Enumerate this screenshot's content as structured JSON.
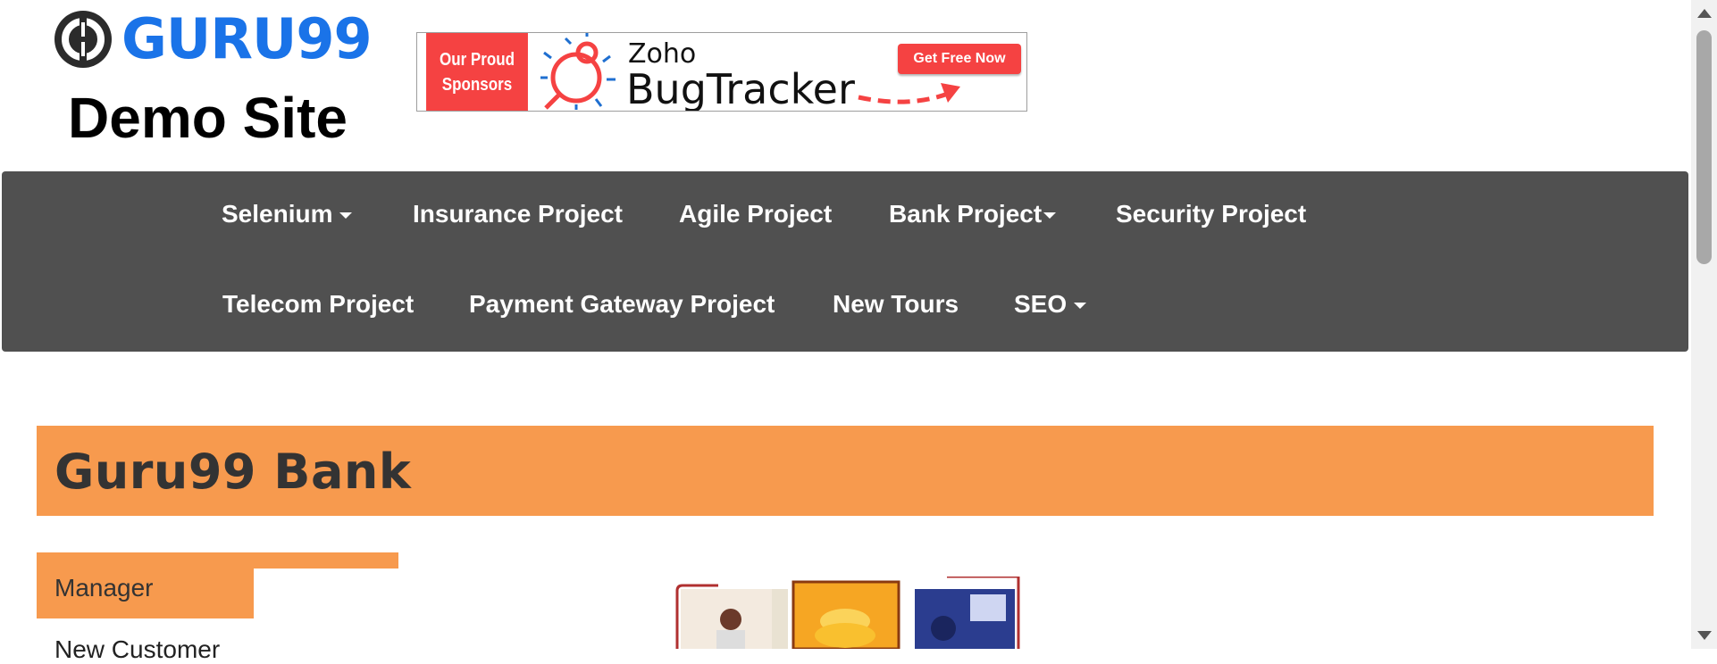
{
  "logo": {
    "brand": "GURU99",
    "subtitle": "Demo Site"
  },
  "banner": {
    "sponsor_line1": "Our Proud",
    "sponsor_line2": "Sponsors",
    "product_small": "Zoho",
    "product_large": "BugTracker",
    "cta": "Get Free Now"
  },
  "nav": {
    "row1": [
      {
        "label": "Selenium",
        "dropdown": true
      },
      {
        "label": "Insurance Project",
        "dropdown": false
      },
      {
        "label": "Agile Project",
        "dropdown": false
      },
      {
        "label": "Bank Project",
        "dropdown": true
      },
      {
        "label": "Security Project",
        "dropdown": false
      }
    ],
    "row2": [
      {
        "label": "Telecom Project",
        "dropdown": false
      },
      {
        "label": "Payment Gateway Project",
        "dropdown": false
      },
      {
        "label": "New Tours",
        "dropdown": false
      },
      {
        "label": "SEO",
        "dropdown": true
      }
    ]
  },
  "bank": {
    "title": "Guru99 Bank"
  },
  "sidebar": {
    "heading": "Manager",
    "items": [
      {
        "label": "New Customer"
      }
    ]
  },
  "colors": {
    "brand_blue": "#1a73e8",
    "navbar_bg": "#505050",
    "accent_orange": "#f79a4e",
    "sponsor_red": "#f54242"
  }
}
